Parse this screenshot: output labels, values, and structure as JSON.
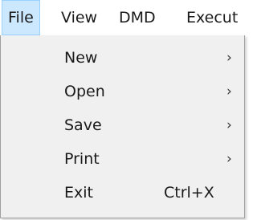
{
  "menubar": {
    "items": [
      {
        "label": "File"
      },
      {
        "label": "View"
      },
      {
        "label": "DMD"
      },
      {
        "label": "Execut"
      }
    ]
  },
  "file_menu": {
    "items": [
      {
        "label": "New",
        "submenu_glyph": "›"
      },
      {
        "label": "Open",
        "submenu_glyph": "›"
      },
      {
        "label": "Save",
        "submenu_glyph": "›"
      },
      {
        "label": "Print",
        "submenu_glyph": "›"
      },
      {
        "label": "Exit",
        "shortcut": "Ctrl+X"
      }
    ]
  },
  "colors": {
    "active_menu_bg": "#cce8ff",
    "active_menu_border": "#99d1ff",
    "dropdown_bg": "#f0f0f0"
  }
}
